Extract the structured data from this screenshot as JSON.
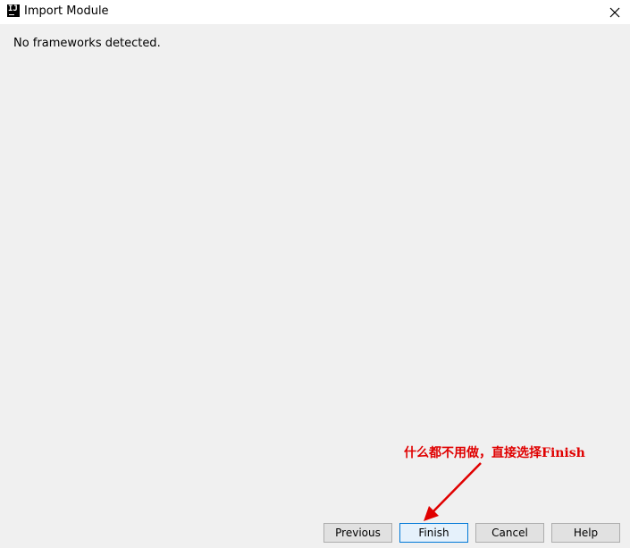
{
  "window": {
    "title": "Import Module",
    "app_icon_text": "IJ",
    "close_icon": "close-icon"
  },
  "content": {
    "message": "No frameworks detected."
  },
  "annotation": {
    "text": "什么都不用做，直接选择Finish",
    "color": "#e00000"
  },
  "buttons": {
    "previous": "Previous",
    "finish": "Finish",
    "cancel": "Cancel",
    "help": "Help"
  }
}
